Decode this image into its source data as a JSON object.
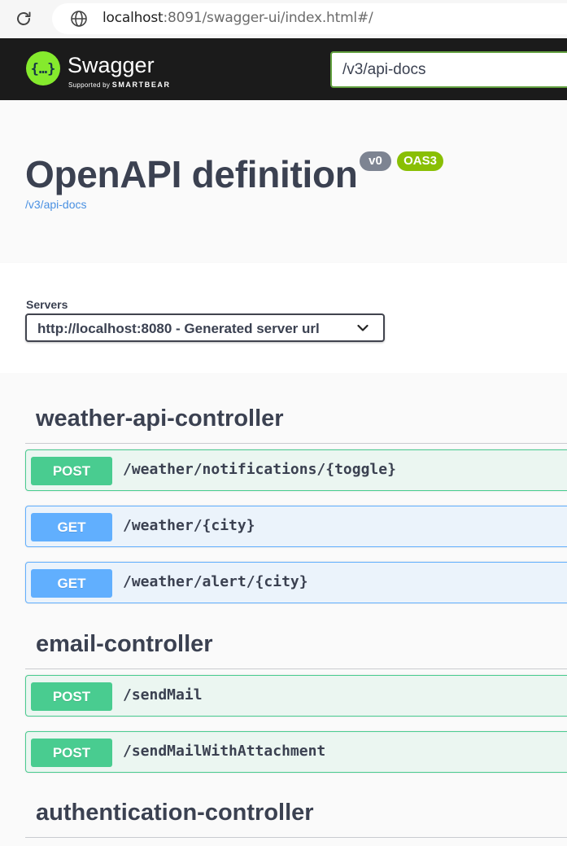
{
  "browser": {
    "url_host": "localhost",
    "url_rest": ":8091/swagger-ui/index.html#/"
  },
  "topbar": {
    "brand": "Swagger",
    "supported_by": "Supported by",
    "smartbear": "SMARTBEAR",
    "spec_url": "/v3/api-docs"
  },
  "info": {
    "title": "OpenAPI definition",
    "version_badge": "v0",
    "oas_badge": "OAS3",
    "docs_link": "/v3/api-docs"
  },
  "servers": {
    "label": "Servers",
    "selected": "http://localhost:8080 - Generated server url"
  },
  "tags": [
    {
      "name": "weather-api-controller",
      "operations": [
        {
          "method": "POST",
          "path": "/weather/notifications/{toggle}"
        },
        {
          "method": "GET",
          "path": "/weather/{city}"
        },
        {
          "method": "GET",
          "path": "/weather/alert/{city}"
        }
      ]
    },
    {
      "name": "email-controller",
      "operations": [
        {
          "method": "POST",
          "path": "/sendMail"
        },
        {
          "method": "POST",
          "path": "/sendMailWithAttachment"
        }
      ]
    },
    {
      "name": "authentication-controller",
      "operations": []
    }
  ],
  "colors": {
    "post": "#49cc90",
    "get": "#61affe",
    "topbar": "#1b1b1b",
    "swagger_green": "#85ea2d",
    "link": "#4990e2"
  }
}
